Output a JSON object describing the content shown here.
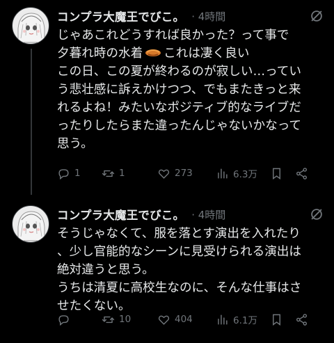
{
  "tweets": [
    {
      "display_name": "コンプラ大魔王でびこ。",
      "meta": "· 4時間",
      "lines": [
        "じゃあこれどうすれば良かった？って事で",
        "夕暮れ時の水着",
        "この日、この夏が終わるのが寂しい…ってい",
        "う悲壮感に訴えかけつつ、でもまたきっと来",
        "れるよね！みたいなポジティブ的なライブだ",
        "ったりしたらまた違ったんじゃないかなって",
        "思う。"
      ],
      "line2_suffix": "これは凄く良い",
      "inline_icon": "flying-disc-icon",
      "reply_count": "1",
      "retweet_count": "1",
      "like_count": "273",
      "view_count": "6.3万"
    },
    {
      "display_name": "コンプラ大魔王でびこ。",
      "meta": "· 4時間",
      "lines": [
        "そうじゃなくて、服を落とす演出を入れたり",
        "、少し官能的なシーンに見受けられる演出は",
        "絶対違うと思う。",
        "うちは清夏に高校生なのに、そんな仕事はさ",
        "せたくない。"
      ],
      "reply_count": "",
      "retweet_count": "10",
      "like_count": "404",
      "view_count": "6.1万"
    }
  ],
  "colors": {
    "background": "#000000",
    "text": "#e7e9ea",
    "muted": "#71767b",
    "thread_line": "#333639"
  }
}
